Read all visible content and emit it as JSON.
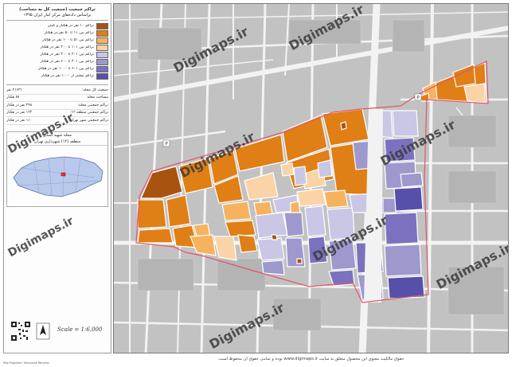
{
  "colors": {
    "c1": "#a85410",
    "c2": "#e07f16",
    "c3": "#f6b25e",
    "c4": "#fad3a6",
    "c5": "#c9c6e6",
    "c6": "#9d99cd",
    "c7": "#7a72bf",
    "c8": "#5750aa",
    "boundary": "#e0566a",
    "street": "#f2f2f2",
    "block_gray": "#bdbdbd"
  },
  "title": {
    "line1": "تراکم جمعیت (جمعیت کل به مساحت)",
    "line2": "براساس داده‌های مرکز آمار ایران ۱۳۹۵"
  },
  "legend": [
    {
      "label": "تراکم ۱۰ نفر در هکتار و کمتر",
      "color_key": "c1"
    },
    {
      "label": "تراکم بین ۱۱ تا ۵۰ نفر در هکتار",
      "color_key": "c2"
    },
    {
      "label": "تراکم بین ۵۱ تا ۱۰۰ نفر در هکتار",
      "color_key": "c3"
    },
    {
      "label": "تراکم بین ۱۰۱ تا ۲۰۰ نفر در هکتار",
      "color_key": "c4"
    },
    {
      "label": "تراکم بین ۲۰۱ تا ۴۰۰ نفر در هکتار",
      "color_key": "c5"
    },
    {
      "label": "تراکم بین ۴۰۱ تا ۶۰۰ نفر در هکتار",
      "color_key": "c6"
    },
    {
      "label": "تراکم بین ۶۰۱ تا ۱۰۰۰ نفر در هکتار",
      "color_key": "c7"
    },
    {
      "label": "تراکم بیشتر از ۱۰۰۰ نفر در هکتار",
      "color_key": "c8"
    }
  ],
  "stats": [
    {
      "label": "جمعیت کل محله:",
      "value": "۲۱۶۳۱ نفر"
    },
    {
      "label": "مساحت محله:",
      "value": "۸۷ هکتار"
    },
    {
      "label": "تراکم جمعیتی محله:",
      "value": "۲۴۸ نفر در هکتار"
    },
    {
      "label": "تراکم جمعیتی منطقه ۱۲:",
      "value": "۱۲۲ نفر در هکتار"
    },
    {
      "label": "تراکم جمعیتی شهر تهران:",
      "value": "۱۱۰ نفر در هکتار"
    }
  ],
  "locator": {
    "line1": "محله شهید اسدی",
    "line2": "منطقه (۱۲) شهرداری تهران"
  },
  "scale": "Scale = 1:6,000",
  "north_label": "N",
  "watermark": "Digimaps.ir",
  "copyright": "حقوق مالکیت معنوی این محصول متعلق به سایت www.digimaps.ir بوده و تمامی حقوق آن محفوظ است.",
  "footer_credit": "Map Projection: Transverse Mercator"
}
